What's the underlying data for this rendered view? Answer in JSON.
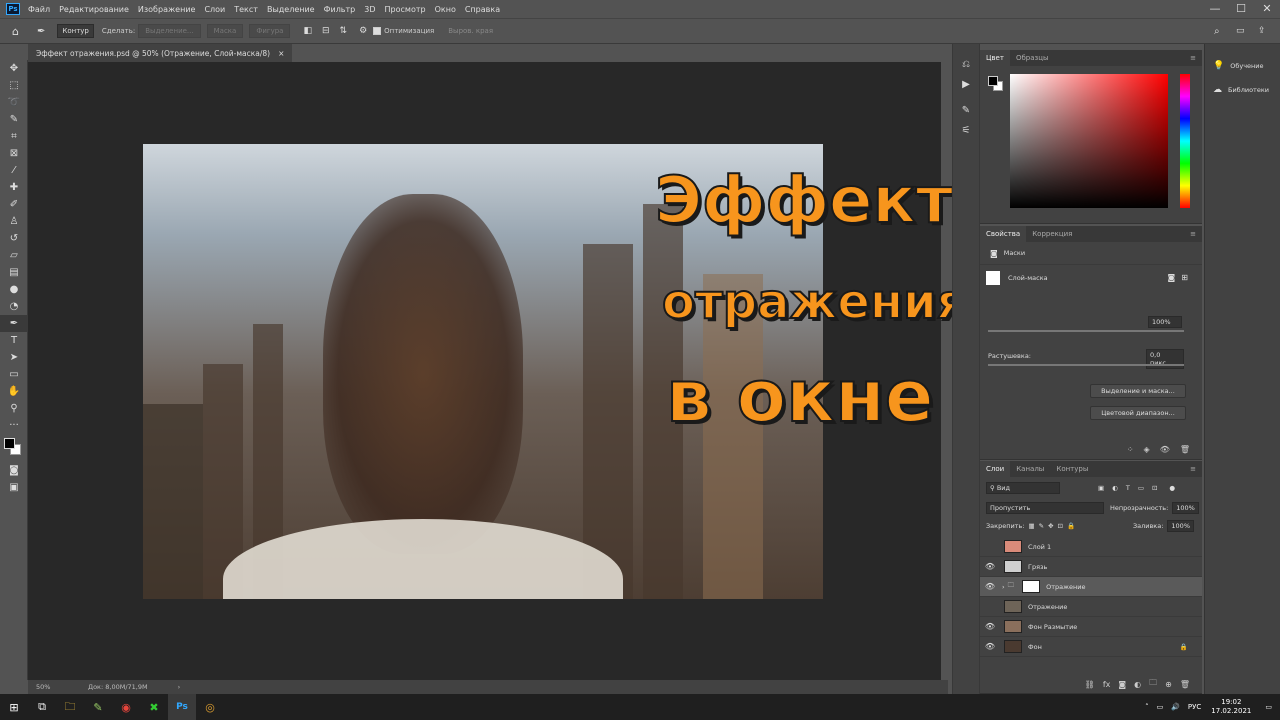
{
  "app": {
    "logo": "Ps"
  },
  "menu": [
    "Файл",
    "Редактирование",
    "Изображение",
    "Слои",
    "Текст",
    "Выделение",
    "Фильтр",
    "3D",
    "Просмотр",
    "Окно",
    "Справка"
  ],
  "window_controls": {
    "minimize": "—",
    "maximize": "☐",
    "close": "✕"
  },
  "options": {
    "mode": "Контур",
    "make_label": "Сделать:",
    "selection": "Выделение...",
    "mask": "Маска",
    "shape": "Фигура",
    "optimization": "Оптимизация",
    "align_edges": "Выров. края"
  },
  "document": {
    "tab_title": "Эффект отражения.psd @ 50% (Отражение, Слой-маска/8)",
    "tab_close": "×",
    "zoom": "50%",
    "doc_info": "Док: 8,00M/71,9M"
  },
  "overlay": {
    "line1": "Эффект",
    "line2": "отражения",
    "line3": "в окне"
  },
  "color_panel": {
    "tabs": [
      "Цвет",
      "Образцы"
    ]
  },
  "properties_panel": {
    "tabs": [
      "Свойства",
      "Коррекция"
    ],
    "masks_label": "Маски",
    "layer_mask_label": "Слой-маска",
    "density_value": "100%",
    "feather_label": "Растушевка:",
    "feather_value": "0,0 пикс.",
    "btn_select_mask": "Выделение и маска...",
    "btn_color_range": "Цветовой диапазон..."
  },
  "layers_panel": {
    "tabs": [
      "Слои",
      "Каналы",
      "Контуры"
    ],
    "filter_kind": "Вид",
    "blend_mode": "Пропустить",
    "opacity_label": "Непрозрачность:",
    "opacity_value": "100%",
    "lock_label": "Закрепить:",
    "fill_label": "Заливка:",
    "fill_value": "100%",
    "layers": [
      {
        "name": "Слой 1",
        "visible": false,
        "thumb": "#d98b7a"
      },
      {
        "name": "Грязь",
        "visible": true,
        "thumb": "#cfcfcf"
      },
      {
        "name": "Отражение",
        "visible": true,
        "thumb": "#7a6a5a",
        "group": true
      },
      {
        "name": "Отражение",
        "visible": false,
        "thumb": "#6e6458"
      },
      {
        "name": "Фон Размытие",
        "visible": true,
        "thumb": "#8a6f5c"
      },
      {
        "name": "Фон",
        "visible": true,
        "thumb": "#4a3a30"
      }
    ]
  },
  "libraries": {
    "learn": "Обучение",
    "libraries": "Библиотеки"
  },
  "taskbar": {
    "lang": "РУС",
    "time": "19:02",
    "date": "17.02.2021"
  }
}
